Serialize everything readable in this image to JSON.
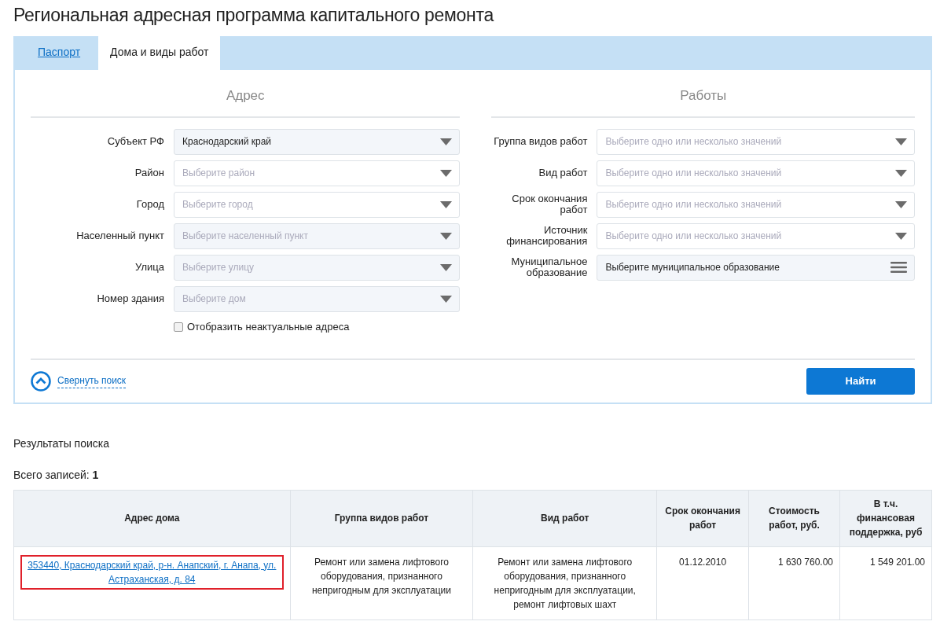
{
  "page_title": "Региональная адресная программа капитального ремонта",
  "tabs": [
    {
      "label": "Паспорт",
      "selected": false
    },
    {
      "label": "Дома и виды работ",
      "selected": true
    }
  ],
  "address_section": {
    "heading": "Адрес",
    "fields": [
      {
        "label": "Субъект РФ",
        "kind": "select",
        "value": "Краснодарский край",
        "disabled": true
      },
      {
        "label": "Район",
        "kind": "select",
        "placeholder": "Выберите район",
        "disabled": false
      },
      {
        "label": "Город",
        "kind": "select",
        "placeholder": "Выберите город",
        "disabled": false
      },
      {
        "label": "Населенный пункт",
        "kind": "select",
        "placeholder": "Выберите населенный пункт",
        "disabled": true
      },
      {
        "label": "Улица",
        "kind": "select",
        "placeholder": "Выберите улицу",
        "disabled": true
      },
      {
        "label": "Номер здания",
        "kind": "select",
        "placeholder": "Выберите дом",
        "disabled": true
      }
    ],
    "checkbox": {
      "label": "Отобразить неактуальные адреса",
      "checked": false
    }
  },
  "works_section": {
    "heading": "Работы",
    "fields": [
      {
        "label": "Группа видов работ",
        "kind": "select",
        "placeholder": "Выберите одно или несколько значений",
        "disabled": false
      },
      {
        "label": "Вид работ",
        "kind": "select",
        "placeholder": "Выберите одно или несколько значений",
        "disabled": false
      },
      {
        "label": "Срок окончания работ",
        "kind": "select",
        "placeholder": "Выберите одно или несколько значений",
        "disabled": false
      },
      {
        "label": "Источник финансирования",
        "kind": "select",
        "placeholder": "Выберите одно или несколько значений",
        "disabled": false
      },
      {
        "label": "Муниципальное образование",
        "kind": "picker",
        "text": "Выберите муниципальное образование",
        "disabled": true
      }
    ]
  },
  "collapse_link": "Свернуть поиск",
  "search_button": "Найти",
  "results_title": "Результаты поиска",
  "total": {
    "label": "Всего записей:",
    "count": "1"
  },
  "table": {
    "columns": [
      "Адрес дома",
      "Группа видов работ",
      "Вид работ",
      "Срок окончания работ",
      "Стоимость работ, руб.",
      "В т.ч. финансовая поддержка, руб"
    ],
    "rows": [
      {
        "highlighted": true,
        "cells": [
          "353440, Краснодарский край, р-н. Анапский, г. Анапа, ул. Астраханская, д. 84",
          "Ремонт или замена лифтового оборудования, признанного непригодным для эксплуатации",
          "Ремонт или замена лифтового оборудования, признанного непригодным для эксплуатации, ремонт лифтовых шахт",
          "01.12.2010",
          "1 630 760.00",
          "1 549 201.00"
        ]
      }
    ]
  }
}
